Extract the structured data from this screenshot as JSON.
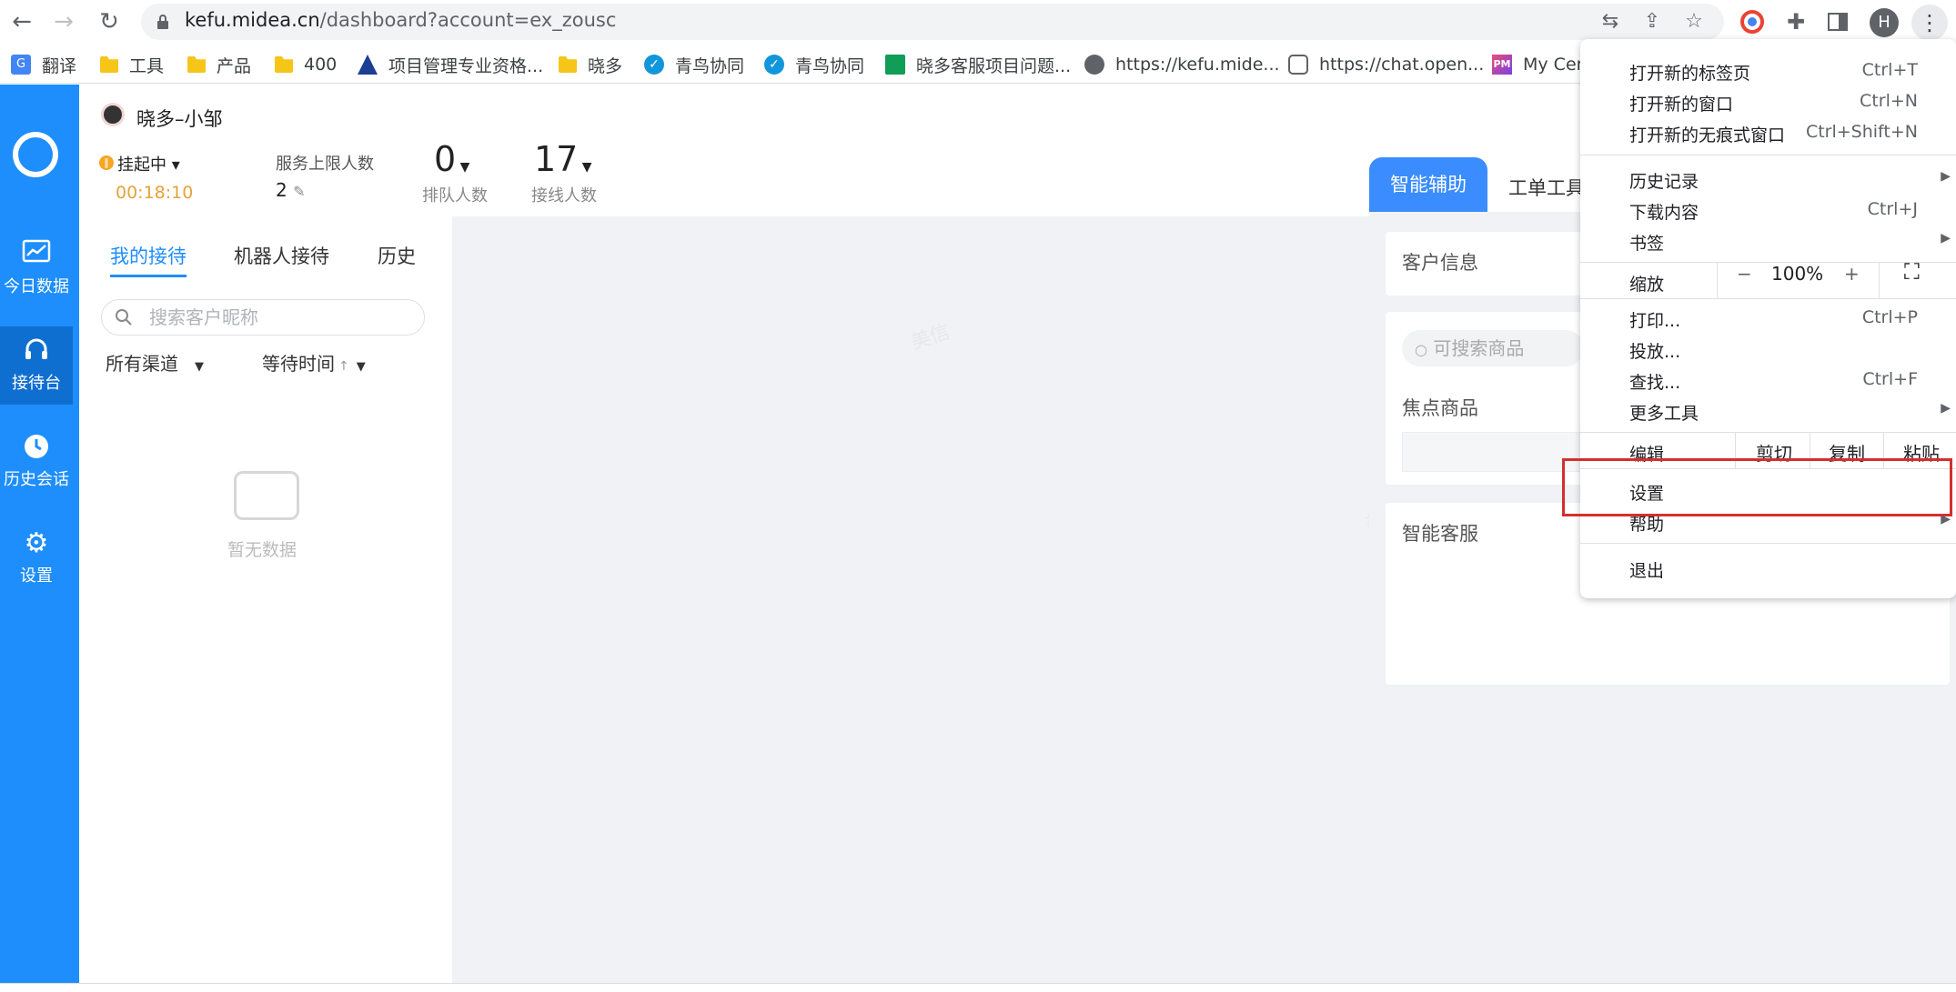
{
  "browser": {
    "url_host": "kefu.midea.cn",
    "url_path": "/dashboard?account=ex_zousc",
    "profile_initial": "H"
  },
  "bookmarks": [
    {
      "label": "翻译",
      "icon": "translate-icon"
    },
    {
      "label": "工具",
      "icon": "folder-icon"
    },
    {
      "label": "产品",
      "icon": "folder-icon"
    },
    {
      "label": "400",
      "icon": "folder-icon"
    },
    {
      "label": "项目管理专业资格...",
      "icon": "pmi-icon"
    },
    {
      "label": "晓多",
      "icon": "folder-icon"
    },
    {
      "label": "青鸟协同",
      "icon": "check-icon"
    },
    {
      "label": "青鸟协同",
      "icon": "check-icon"
    },
    {
      "label": "晓多客服项目问题...",
      "icon": "sheet-icon"
    },
    {
      "label": "https://kefu.mide...",
      "icon": "globe-icon"
    },
    {
      "label": "https://chat.open...",
      "icon": "chatgpt-icon"
    },
    {
      "label": "My Cer",
      "icon": "pm-icon"
    }
  ],
  "sidebar": {
    "items": [
      {
        "label": "今日数据",
        "icon": "chart-icon"
      },
      {
        "label": "接待台",
        "icon": "headset-icon"
      },
      {
        "label": "历史会话",
        "icon": "clock-icon"
      },
      {
        "label": "设置",
        "icon": "gear-icon"
      }
    ]
  },
  "header": {
    "agent_name": "晓多–小邹",
    "status": "挂起中 ▾",
    "timer": "00:18:10",
    "limit_label": "服务上限人数",
    "limit_value": "2",
    "queue_value": "0",
    "queue_label": "排队人数",
    "served_value": "17",
    "served_label": "接线人数"
  },
  "left_panel": {
    "tabs": [
      "我的接待",
      "机器人接待",
      "历史"
    ],
    "search_placeholder": "搜索客户昵称",
    "filter_channel": "所有渠道",
    "filter_wait": "等待时间",
    "empty_text": "暂无数据"
  },
  "right_panel": {
    "tabs": [
      "智能辅助",
      "工单工具"
    ],
    "customer_info": "客户信息",
    "product_search_placeholder": "可搜索商品",
    "focus_products": "焦点商品",
    "smart_service": "智能客服"
  },
  "menu": {
    "new_tab": "打开新的标签页",
    "new_tab_sc": "Ctrl+T",
    "new_window": "打开新的窗口",
    "new_window_sc": "Ctrl+N",
    "incognito": "打开新的无痕式窗口",
    "incognito_sc": "Ctrl+Shift+N",
    "history": "历史记录",
    "downloads": "下载内容",
    "downloads_sc": "Ctrl+J",
    "bookmarks": "书签",
    "zoom": "缩放",
    "zoom_minus": "−",
    "zoom_value": "100%",
    "zoom_plus": "+",
    "print": "打印...",
    "print_sc": "Ctrl+P",
    "cast": "投放...",
    "find": "查找...",
    "find_sc": "Ctrl+F",
    "more_tools": "更多工具",
    "edit": "编辑",
    "cut": "剪切",
    "copy": "复制",
    "paste": "粘贴",
    "settings": "设置",
    "help": "帮助",
    "exit": "退出"
  },
  "colors": {
    "sidebar_blue": "#1e8efc",
    "highlight_red": "#d32f2f",
    "timer_orange": "#e6a23c"
  },
  "watermark": "美信"
}
